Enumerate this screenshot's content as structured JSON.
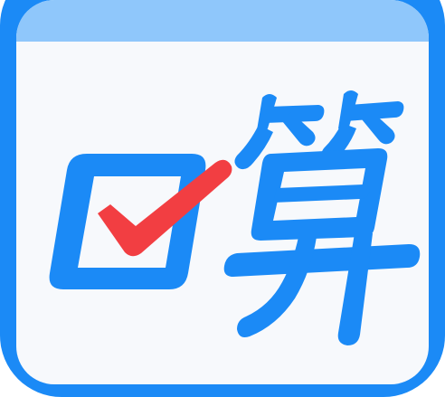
{
  "app_icon": {
    "name": "口算",
    "glyph": "算",
    "colors": {
      "frame": "#1b8af6",
      "header_band": "#8fc7fb",
      "card": "#f7f9fc",
      "mark_outline": "#1b8af6",
      "check": "#f23e42"
    },
    "icons": [
      "checkbox-icon",
      "checkmark-icon"
    ]
  }
}
